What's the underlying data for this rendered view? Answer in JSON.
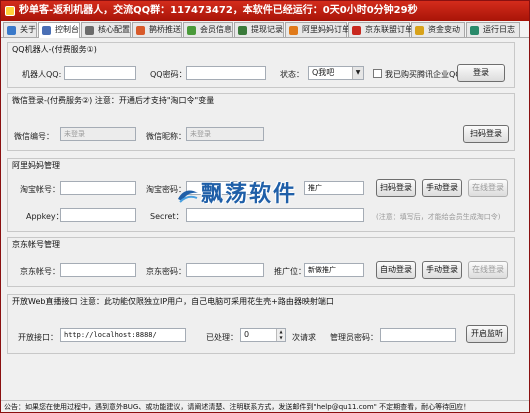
{
  "window": {
    "title": "秒单客-返利机器人，交流QQ群：117473472，本软件已经运行：0天0小时0分钟29秒"
  },
  "tabs": [
    {
      "label": "关于",
      "icon": "info-icon",
      "color": "#3a79c9"
    },
    {
      "label": "控制台",
      "icon": "console-icon",
      "color": "#4a6fb5"
    },
    {
      "label": "核心配置",
      "icon": "gear-icon",
      "color": "#6b6b6b"
    },
    {
      "label": "鹊桥推送",
      "icon": "bridge-icon",
      "color": "#d85a2a"
    },
    {
      "label": "会员信息",
      "icon": "member-icon",
      "color": "#4a9a3a"
    },
    {
      "label": "提现记录",
      "icon": "withdraw-icon",
      "color": "#3a7a3a"
    },
    {
      "label": "阿里妈妈订单",
      "icon": "alimama-icon",
      "color": "#e07a1a"
    },
    {
      "label": "京东联盟订单",
      "icon": "jd-icon",
      "color": "#c8281e"
    },
    {
      "label": "资金变动",
      "icon": "money-icon",
      "color": "#d8a21a"
    },
    {
      "label": "运行日志",
      "icon": "log-icon",
      "color": "#2a8a6a"
    }
  ],
  "active_tab": "控制台",
  "qq_group": {
    "title": "QQ机器人-(付费服务①)",
    "robot_qq_label": "机器人QQ:",
    "robot_qq_value": "",
    "qq_pwd_label": "QQ密码：",
    "qq_pwd_value": "",
    "status_label": "状态：",
    "status_value": "Q我吧",
    "checkbox_label": "我已购买腾讯企业QQ",
    "login_button": "登录"
  },
  "wechat_group": {
    "title": "微信登录-(付费服务②)  注意：开通后才支持\"淘口令\"变量",
    "wechat_id_label": "微信编号：",
    "wechat_id_value": "未登录",
    "wechat_nick_label": "微信昵称：",
    "wechat_nick_value": "未登录",
    "scan_button": "扫码登录"
  },
  "alimama_group": {
    "title": "阿里妈妈管理",
    "taobao_account_label": "淘宝帐号：",
    "taobao_account_value": "",
    "taobao_pwd_label": "淘宝密码：",
    "taobao_pwd_value": "",
    "promo_value": "推广",
    "scan_button": "扫码登录",
    "manual_button": "手动登录",
    "status_button": "在线登录",
    "appkey_label": "Appkey：",
    "appkey_value": "",
    "secret_label": "Secret：",
    "secret_value": "",
    "note": "(注意：填写后，才能给会员生成淘口令)"
  },
  "watermark": {
    "text": "飘荡软件"
  },
  "jd_group": {
    "title": "京东帐号管理",
    "jd_account_label": "京东帐号：",
    "jd_account_value": "",
    "jd_pwd_label": "京东密码：",
    "jd_pwd_value": "",
    "promo_label": "推广位：",
    "promo_value": "新做推广",
    "auto_button": "自动登录",
    "manual_button": "手动登录",
    "status_button": "在线登录"
  },
  "web_group": {
    "title": "开放Web直播接口  注意：此功能仅限独立IP用户，自己电脑可采用花生壳+路由器映射端口",
    "port_label": "开放接口：",
    "port_value": "http://localhost:8888/",
    "processed_label": "已处理：",
    "processed_value": "0",
    "requests_label": "次请求",
    "admin_pwd_label": "管理员密码：",
    "admin_pwd_value": "",
    "start_button": "开启监听"
  },
  "status_bar": {
    "text": "公告：如果您在使用过程中，遇到意外BUG、或功能建议，请阐述清楚、注明联系方式，发送邮件到\"help@qu11.com\"  不定期查看，耐心等待回应！"
  }
}
